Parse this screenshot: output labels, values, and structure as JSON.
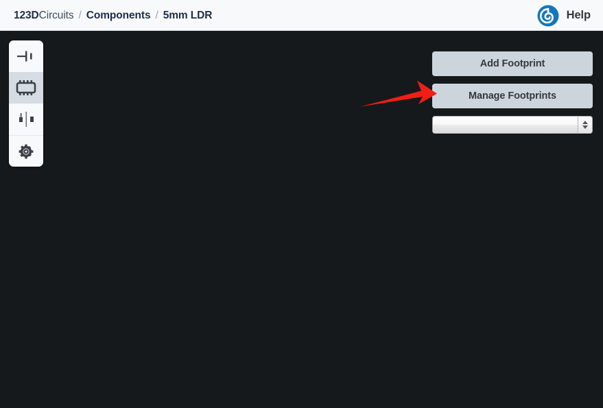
{
  "header": {
    "breadcrumb": {
      "brand_bold": "123D",
      "brand_light": "Circuits",
      "separator": "/",
      "parent": "Components",
      "current": "5mm LDR"
    },
    "help": {
      "label": "Help",
      "icon": "power-logo-icon",
      "icon_color": "#1278bd"
    }
  },
  "sidebar": {
    "items": [
      {
        "name": "schematic-symbol",
        "icon": "capacitor-symbol-icon",
        "selected": false
      },
      {
        "name": "footprint-chip",
        "icon": "ic-chip-icon",
        "selected": true
      },
      {
        "name": "pcb-3d-view",
        "icon": "component-pins-icon",
        "selected": false
      },
      {
        "name": "settings",
        "icon": "gear-icon",
        "selected": false
      }
    ]
  },
  "main": {
    "add_footprint_label": "Add Footprint",
    "manage_footprints_label": "Manage Footprints",
    "footprint_select": {
      "value": "",
      "placeholder": ""
    }
  },
  "annotation": {
    "type": "arrow",
    "color": "#f01e14",
    "points_to": "add-footprint-button",
    "direction": "left-to-right"
  },
  "colors": {
    "header_bg": "#f8f9fa",
    "canvas_bg": "#16191b",
    "panel_bg": "#f8f9fa",
    "panel_selected_bg": "#d6dce4",
    "button_bg": "#ccd4dc",
    "button_text": "#34393f",
    "breadcrumb_text": "#1d2d47",
    "annotation_red": "#f01e14"
  }
}
